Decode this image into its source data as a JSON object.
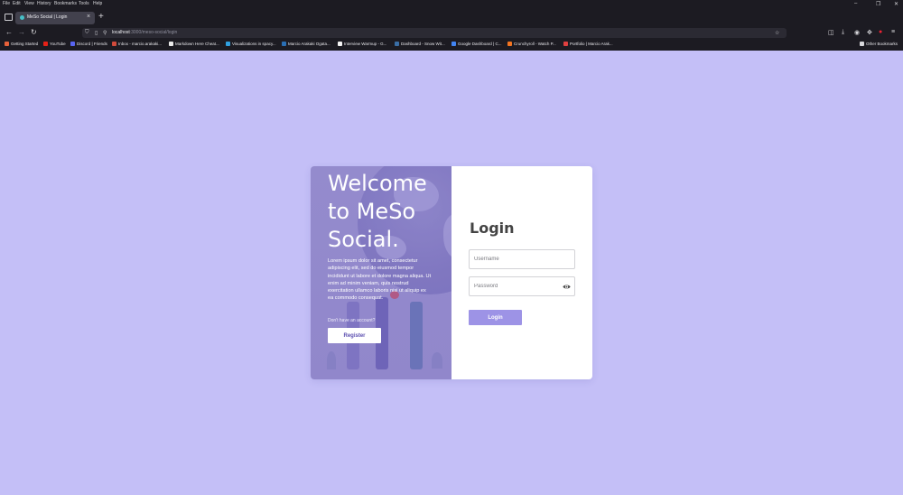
{
  "browser": {
    "menu": [
      "File",
      "Edit",
      "View",
      "History",
      "Bookmarks",
      "Tools",
      "Help"
    ],
    "tab_title": "MeSo Social | Login",
    "url_host": "localhost",
    "url_path": ":3000/meso-social/login",
    "bookmarks": [
      {
        "label": "Getting Started",
        "color": "#e8613a"
      },
      {
        "label": "YouTube",
        "color": "#e62117"
      },
      {
        "label": "Discord | Friends",
        "color": "#5865f2"
      },
      {
        "label": "Inbox - marcio.arakaki...",
        "color": "#d04a3b"
      },
      {
        "label": "Markdown Here Cheat...",
        "color": "#eaeaea"
      },
      {
        "label": "Visualizations in spacy...",
        "color": "#2fa0e0"
      },
      {
        "label": "Marcio Arakaki Ogata...",
        "color": "#2a6fb5"
      },
      {
        "label": "Interview Warmup - G...",
        "color": "#f4f4f4"
      },
      {
        "label": "Dashboard - Snow Wit...",
        "color": "#3a6ea5"
      },
      {
        "label": "Google Dashboard | C...",
        "color": "#4285f4"
      },
      {
        "label": "Crunchyroll - Watch P...",
        "color": "#f47521"
      },
      {
        "label": "Portfolio | Marcio Arak...",
        "color": "#e04040"
      }
    ],
    "other_bookmarks": "Other Bookmarks"
  },
  "welcome": {
    "heading": "Welcome to MeSo Social.",
    "body": "Lorem ipsum dolor sit amet, consectetur adipiscing elit, sed do eiusmod tempor incididunt ut labore et dolore magna aliqua. Ut enim ad minim veniam, quis nostrud exercitation ullamco laboris nisi ut aliquip ex ea commodo consequat.",
    "no_account": "Don't have an account?",
    "register_label": "Register"
  },
  "login": {
    "title": "Login",
    "username_placeholder": "Username",
    "password_placeholder": "Password",
    "button_label": "Login"
  },
  "colors": {
    "page_background": "#c4bff7",
    "panel_purple": "#948bcd",
    "login_button": "#9d93e6",
    "register_text": "#5c4fb0"
  }
}
